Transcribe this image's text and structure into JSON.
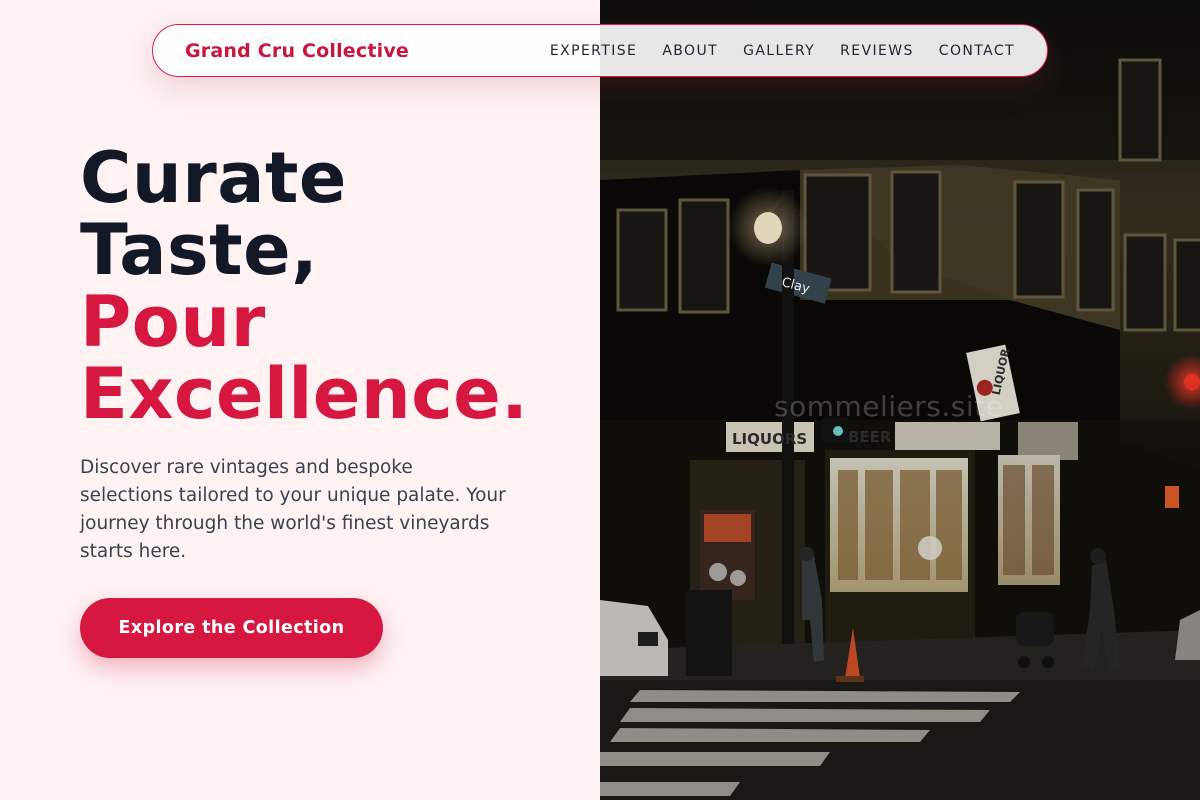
{
  "nav": {
    "brand": "Grand Cru Collective",
    "links": [
      "EXPERTISE",
      "ABOUT",
      "GALLERY",
      "REVIEWS",
      "CONTACT"
    ]
  },
  "hero": {
    "headline_line1": "Curate",
    "headline_line2": "Taste,",
    "headline_line3": "Pour",
    "headline_line4": "Excellence.",
    "description": "Discover rare vintages and bespoke selections tailored to your unique palate. Your journey through the world's finest vineyards starts here.",
    "cta_label": "Explore the Collection"
  },
  "photo": {
    "watermark": "sommeliers.site",
    "street_sign": "Clay",
    "store_sign_left": "LIQUORS",
    "store_sign_right": "BEER",
    "store_sign_hanging": "LIQUOR"
  },
  "colors": {
    "accent": "#d6173f",
    "brand": "#c8163f",
    "headline_dark": "#121826",
    "background": "#fef2f3"
  }
}
